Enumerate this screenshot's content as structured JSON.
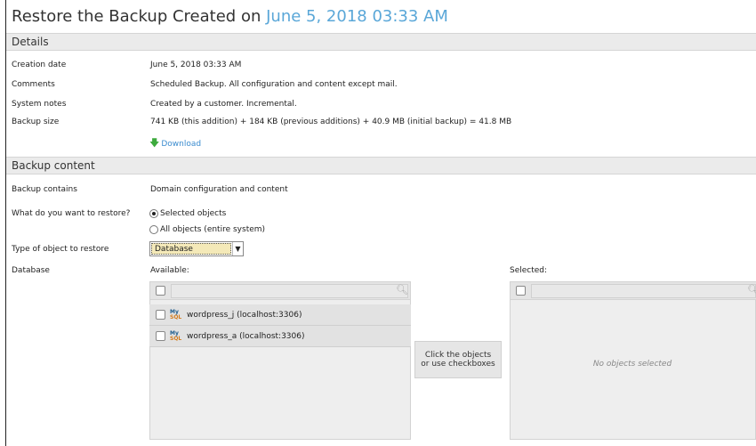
{
  "title": {
    "prefix": "Restore the Backup Created on",
    "date": "June 5, 2018 03:33 AM"
  },
  "details": {
    "heading": "Details",
    "rows": [
      {
        "label": "Creation date",
        "value": "June 5, 2018 03:33 AM"
      },
      {
        "label": "Comments",
        "value": "Scheduled Backup. All configuration and content except mail."
      },
      {
        "label": "System notes",
        "value": "Created by a customer. Incremental."
      },
      {
        "label": "Backup size",
        "value": "741 KB (this addition) + 184 KB (previous additions) + 40.9 MB (initial backup) = 41.8 MB"
      }
    ],
    "download_label": "Download"
  },
  "content": {
    "heading": "Backup content",
    "contains_label": "Backup contains",
    "contains_value": "Domain configuration and content",
    "restore_label": "What do you want to restore?",
    "restore_options": [
      {
        "label": "Selected objects",
        "selected": true
      },
      {
        "label": "All objects (entire system)",
        "selected": false
      }
    ],
    "type_label": "Type of object to restore",
    "type_value": "Database",
    "database_label": "Database"
  },
  "available": {
    "heading": "Available:",
    "items": [
      {
        "icon": "mysql-icon",
        "label": "wordpress_j (localhost:3306)"
      },
      {
        "icon": "mysql-icon",
        "label": "wordpress_a (localhost:3306)"
      }
    ]
  },
  "transfer": {
    "line1": "Click the objects",
    "line2": "or use checkboxes"
  },
  "selected": {
    "heading": "Selected:",
    "empty_text": "No objects selected"
  },
  "colors": {
    "accent": "#5aa7d8",
    "link": "#3b8ccf",
    "download_arrow": "#3daa3d"
  }
}
